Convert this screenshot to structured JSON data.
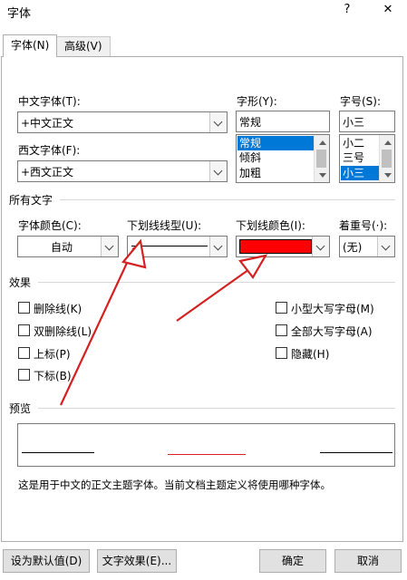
{
  "window": {
    "title": "字体",
    "help_glyph": "?",
    "close_glyph": "✕"
  },
  "tabs": [
    {
      "label": "字体(N)",
      "active": true
    },
    {
      "label": "高级(V)",
      "active": false
    }
  ],
  "font": {
    "chinese_label": "中文字体(T):",
    "chinese_value": "+中文正文",
    "western_label": "西文字体(F):",
    "western_value": "+西文正文",
    "style_label": "字形(Y):",
    "style_value": "常规",
    "style_options": [
      "常规",
      "倾斜",
      "加粗"
    ],
    "style_selected": "常规",
    "size_label": "字号(S):",
    "size_value": "小三",
    "size_options": [
      "小二",
      "三号",
      "小三"
    ],
    "size_selected": "小三"
  },
  "all_text": {
    "section_title": "所有文字",
    "font_color_label": "字体颜色(C):",
    "font_color_value": "自动",
    "underline_style_label": "下划线线型(U):",
    "underline_color_label": "下划线颜色(I):",
    "underline_color_hex": "#ff0000",
    "emphasis_label": "着重号(·):",
    "emphasis_value": "(无)"
  },
  "effects": {
    "section_title": "效果",
    "left": [
      {
        "label": "删除线(K)",
        "checked": false
      },
      {
        "label": "双删除线(L)",
        "checked": false
      },
      {
        "label": "上标(P)",
        "checked": false
      },
      {
        "label": "下标(B)",
        "checked": false
      }
    ],
    "right": [
      {
        "label": "小型大写字母(M)",
        "checked": false
      },
      {
        "label": "全部大写字母(A)",
        "checked": false
      },
      {
        "label": "隐藏(H)",
        "checked": false
      }
    ]
  },
  "preview": {
    "section_title": "预览",
    "note": "这是用于中文的正文主题字体。当前文档主题定义将使用哪种字体。",
    "underline_color": "#e02020"
  },
  "buttons": {
    "set_default": "设为默认值(D)",
    "text_effects": "文字效果(E)...",
    "ok": "确定",
    "cancel": "取消"
  },
  "colors": {
    "annotation_arrow": "#d42020",
    "selection": "#0078d7"
  }
}
